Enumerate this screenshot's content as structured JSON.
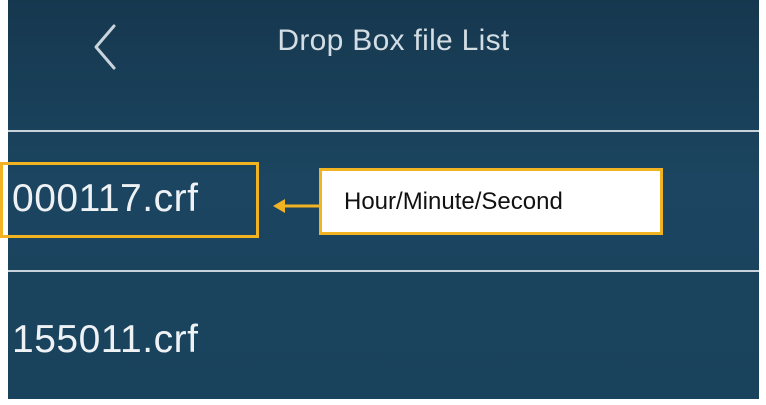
{
  "header": {
    "title": "Drop Box file List",
    "back_icon": "chevron-left-icon"
  },
  "files": [
    {
      "name": "000117.crf"
    },
    {
      "name": "155011.crf"
    }
  ],
  "annotation": {
    "label": "Hour/Minute/Second",
    "accent_color": "#f2b323"
  },
  "colors": {
    "background": "#1b4560",
    "text": "#eef2f5",
    "divider": "#c7d2da"
  }
}
